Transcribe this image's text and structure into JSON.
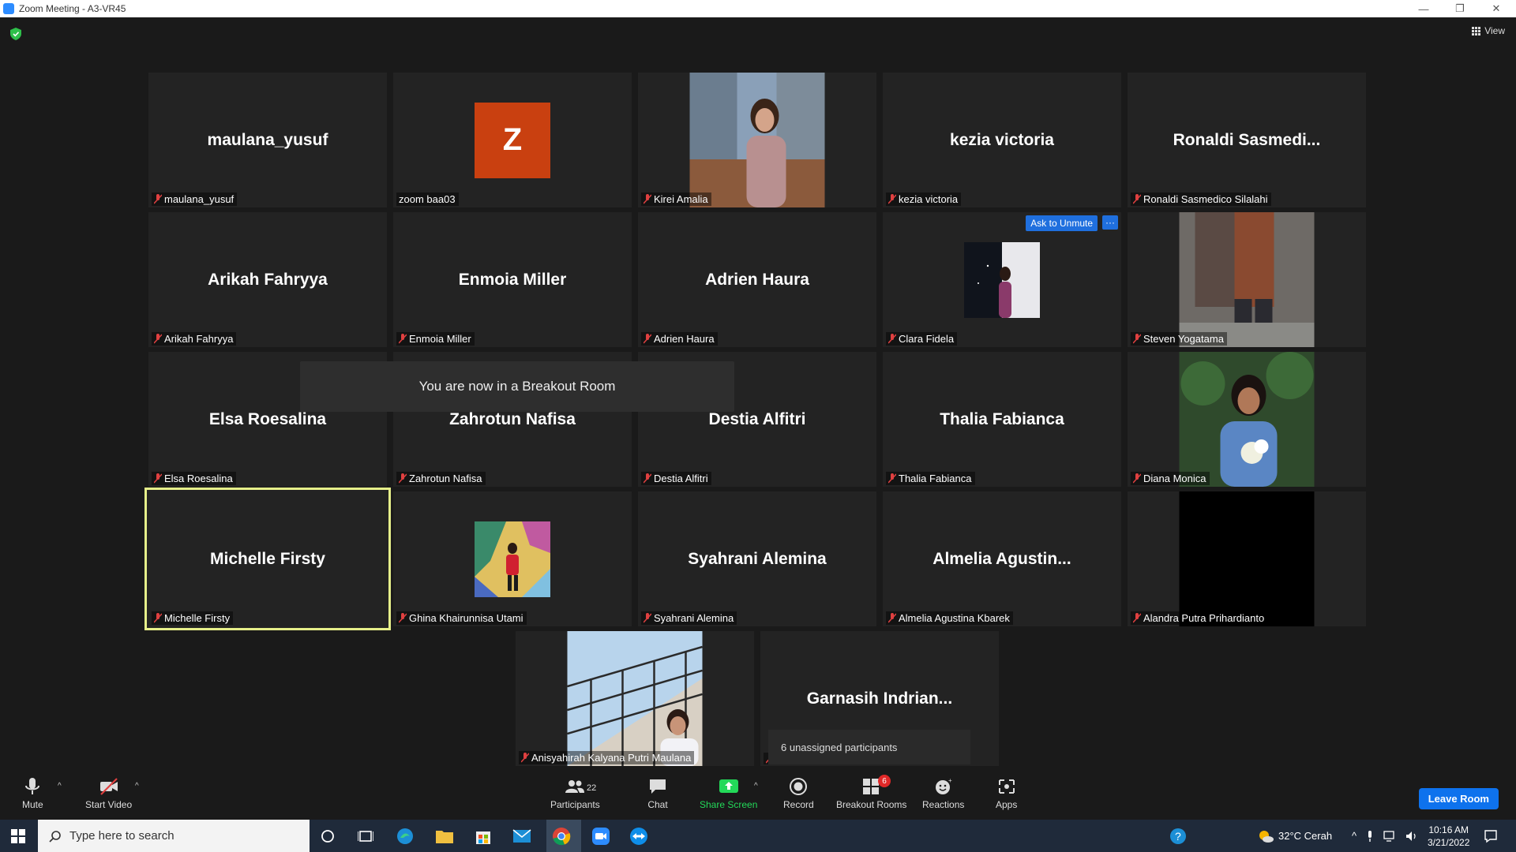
{
  "window": {
    "title": "Zoom Meeting - A3-VR45",
    "minimize": "—",
    "restore": "❐",
    "close": "✕"
  },
  "header": {
    "view_label": "View"
  },
  "tiles": [
    {
      "big": "maulana_yusuf",
      "label": "maulana_yusuf"
    },
    {
      "big": "",
      "label": "zoom baa03",
      "avatar": "Z"
    },
    {
      "big": "",
      "label": "Kirei Amalia"
    },
    {
      "big": "kezia victoria",
      "label": "kezia victoria"
    },
    {
      "big": "Ronaldi  Sasmedi...",
      "label": "Ronaldi Sasmedico Silalahi"
    },
    {
      "big": "Arikah Fahryya",
      "label": "Arikah Fahryya"
    },
    {
      "big": "Enmoia Miller",
      "label": "Enmoia Miller"
    },
    {
      "big": "Adrien Haura",
      "label": "Adrien Haura"
    },
    {
      "big": "",
      "label": "Clara Fidela"
    },
    {
      "big": "",
      "label": "Steven Yogatama"
    },
    {
      "big": "Elsa Roesalina",
      "label": "Elsa Roesalina"
    },
    {
      "big": "Zahrotun Nafisa",
      "label": "Zahrotun Nafisa"
    },
    {
      "big": "Destia Alfitri",
      "label": "Destia Alfitri"
    },
    {
      "big": "Thalia Fabianca",
      "label": "Thalia Fabianca"
    },
    {
      "big": "",
      "label": "Diana Monica"
    },
    {
      "big": "Michelle Firsty",
      "label": "Michelle Firsty"
    },
    {
      "big": "",
      "label": "Ghina Khairunnisa Utami"
    },
    {
      "big": "Syahrani Alemina",
      "label": "Syahrani Alemina"
    },
    {
      "big": "Almelia  Agustin...",
      "label": "Almelia Agustina Kbarek"
    },
    {
      "big": "",
      "label": "Alandra Putra Prihardianto"
    },
    {
      "big": "",
      "label": "Anisyahirah Kalyana Putri Maulana"
    },
    {
      "big": "Garnasih  Indrian...",
      "label": ""
    }
  ],
  "controls": {
    "ask_to_unmute": "Ask to Unmute",
    "more": "···"
  },
  "toast": "You are now in a Breakout Room",
  "unassigned": "6 unassigned participants",
  "toolbar": {
    "mute": "Mute",
    "start_video": "Start Video",
    "participants": "Participants",
    "participants_count": "22",
    "chat": "Chat",
    "share_screen": "Share Screen",
    "record": "Record",
    "breakout_rooms": "Breakout Rooms",
    "breakout_badge": "6",
    "reactions": "Reactions",
    "apps": "Apps",
    "leave": "Leave Room"
  },
  "taskbar": {
    "search_placeholder": "Type here to search",
    "weather": "32°C  Cerah",
    "time": "10:16 AM",
    "date": "3/21/2022"
  },
  "colors": {
    "active_speaker": "#e6ef8a",
    "zoom_blue": "#0e72ed",
    "share_green": "#23d959",
    "avatar_orange": "#c94010"
  }
}
